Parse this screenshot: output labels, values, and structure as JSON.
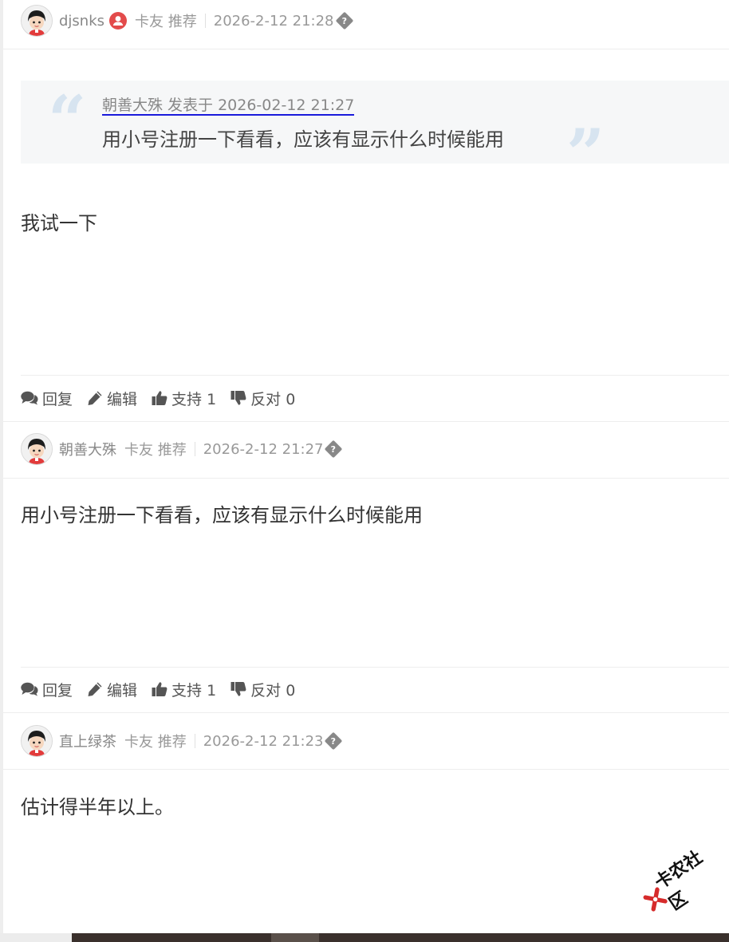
{
  "posts": [
    {
      "username": "djsnks",
      "role": "卡友 推荐",
      "time": "2026-2-12 21:28",
      "unknown_glyph": "?",
      "quote": {
        "link": "朝善大殊 发表于 2026-02-12 21:27",
        "text": "用小号注册一下看看，应该有显示什么时候能用"
      },
      "message": "我试一下",
      "actions": {
        "reply": "回复",
        "edit": "编辑",
        "support": "支持 1",
        "oppose": "反对 0"
      }
    },
    {
      "username": "朝善大殊",
      "role": "卡友 推荐",
      "time": "2026-2-12 21:27",
      "unknown_glyph": "?",
      "message": "用小号注册一下看看，应该有显示什么时候能用",
      "actions": {
        "reply": "回复",
        "edit": "编辑",
        "support": "支持 1",
        "oppose": "反对 0"
      }
    },
    {
      "username": "直上绿茶",
      "role": "卡友 推荐",
      "time": "2026-2-12 21:23",
      "unknown_glyph": "?",
      "message": "估计得半年以上。"
    }
  ],
  "watermark": "卡农社区",
  "icons": {
    "avatar": "cartoon-boy-avatar",
    "badge": "user-badge-icon",
    "reply": "comments-icon",
    "edit": "pencil-icon",
    "support": "thumbs-up-icon",
    "oppose": "thumbs-down-icon"
  },
  "colors": {
    "badge": "#e34b4b",
    "quote_bg": "#f6f7f8",
    "quote_mark": "#d7e4f0",
    "quote_link_underline": "#1a1adb"
  }
}
